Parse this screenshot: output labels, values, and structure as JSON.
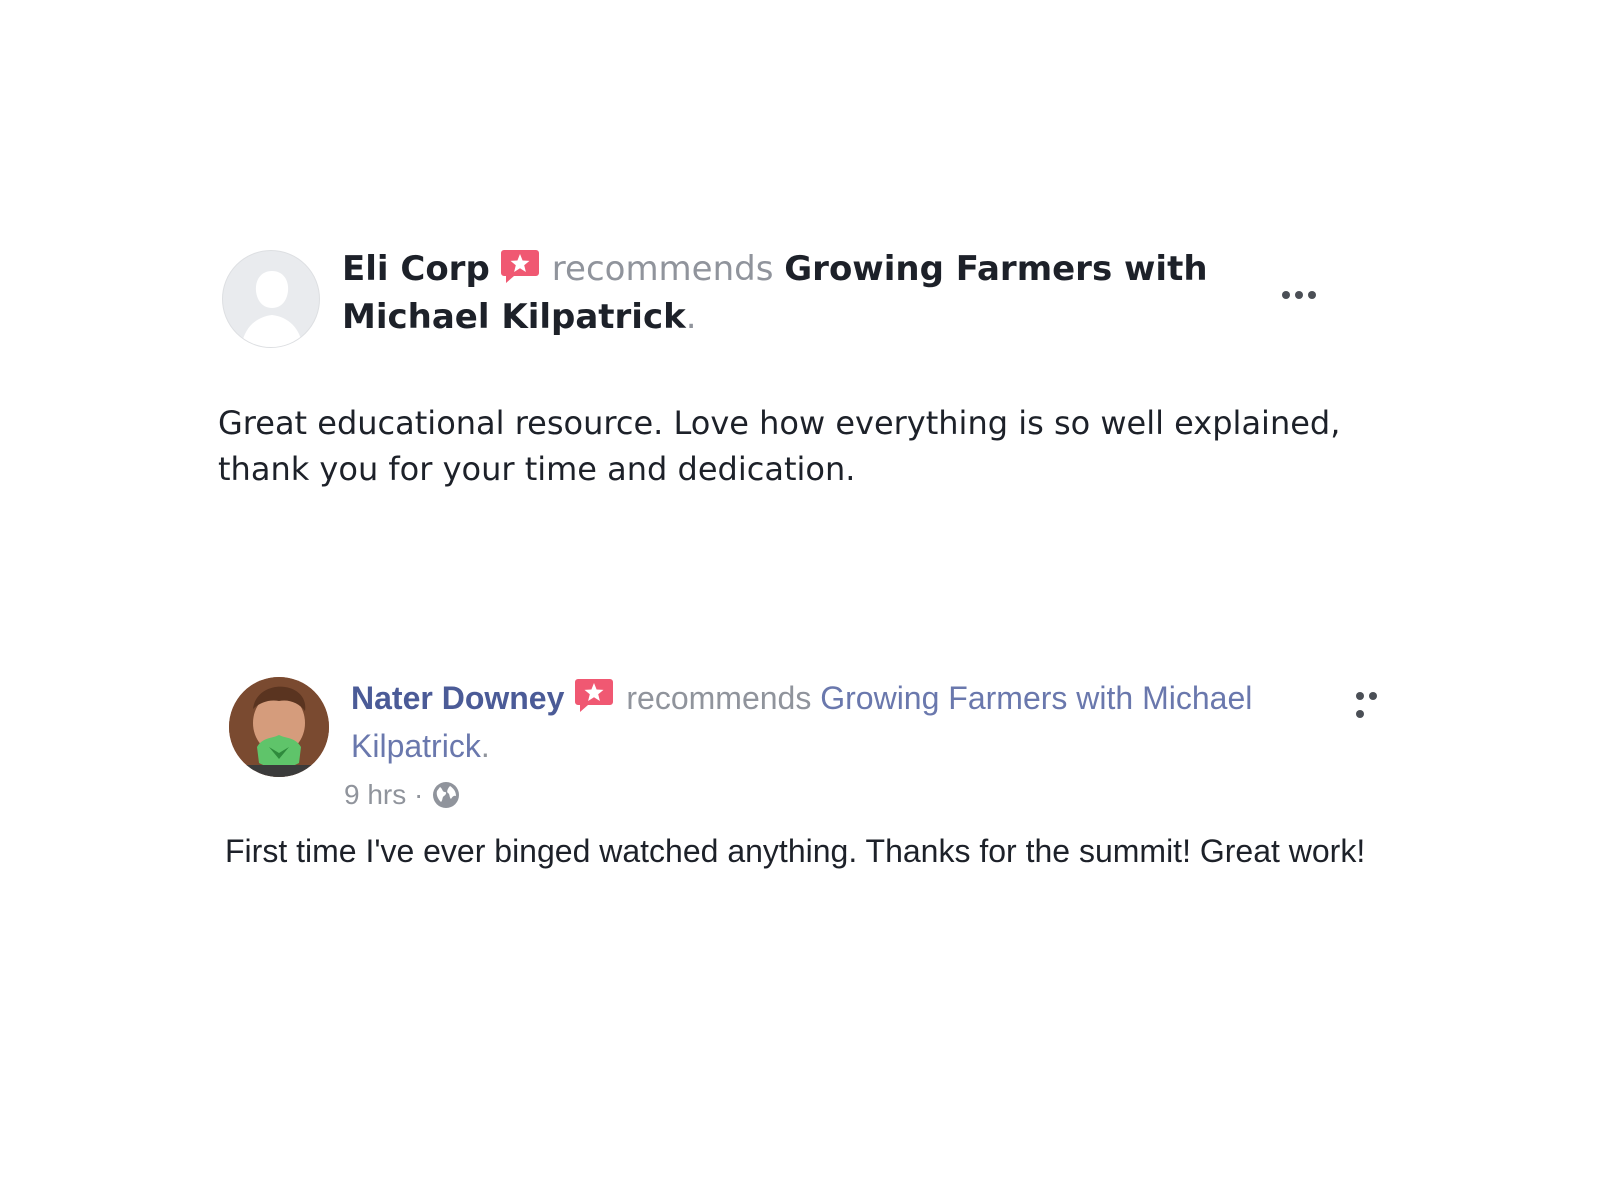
{
  "reviews": [
    {
      "author": "Eli Corp",
      "verb": "recommends",
      "page": "Growing Farmers with Michael Kilpatrick",
      "period": ".",
      "text": "Great educational resource. Love how everything is  so well explained, thank you for your time and dedication."
    },
    {
      "author": "Nater Downey",
      "verb": "recommends",
      "page": "Growing Farmers with Michael Kilpatrick",
      "period": ".",
      "time": "9 hrs",
      "separator": "·",
      "text": "First time I've ever binged watched anything. Thanks for the summit! Great work!"
    }
  ],
  "icons": {
    "badge": "recommendation-star-badge-icon",
    "more": "more-options-icon",
    "privacy": "globe-icon"
  },
  "colors": {
    "badge": "#f05872",
    "name_link": "#4b5b97",
    "muted": "#90949c",
    "text": "#1d2129"
  }
}
